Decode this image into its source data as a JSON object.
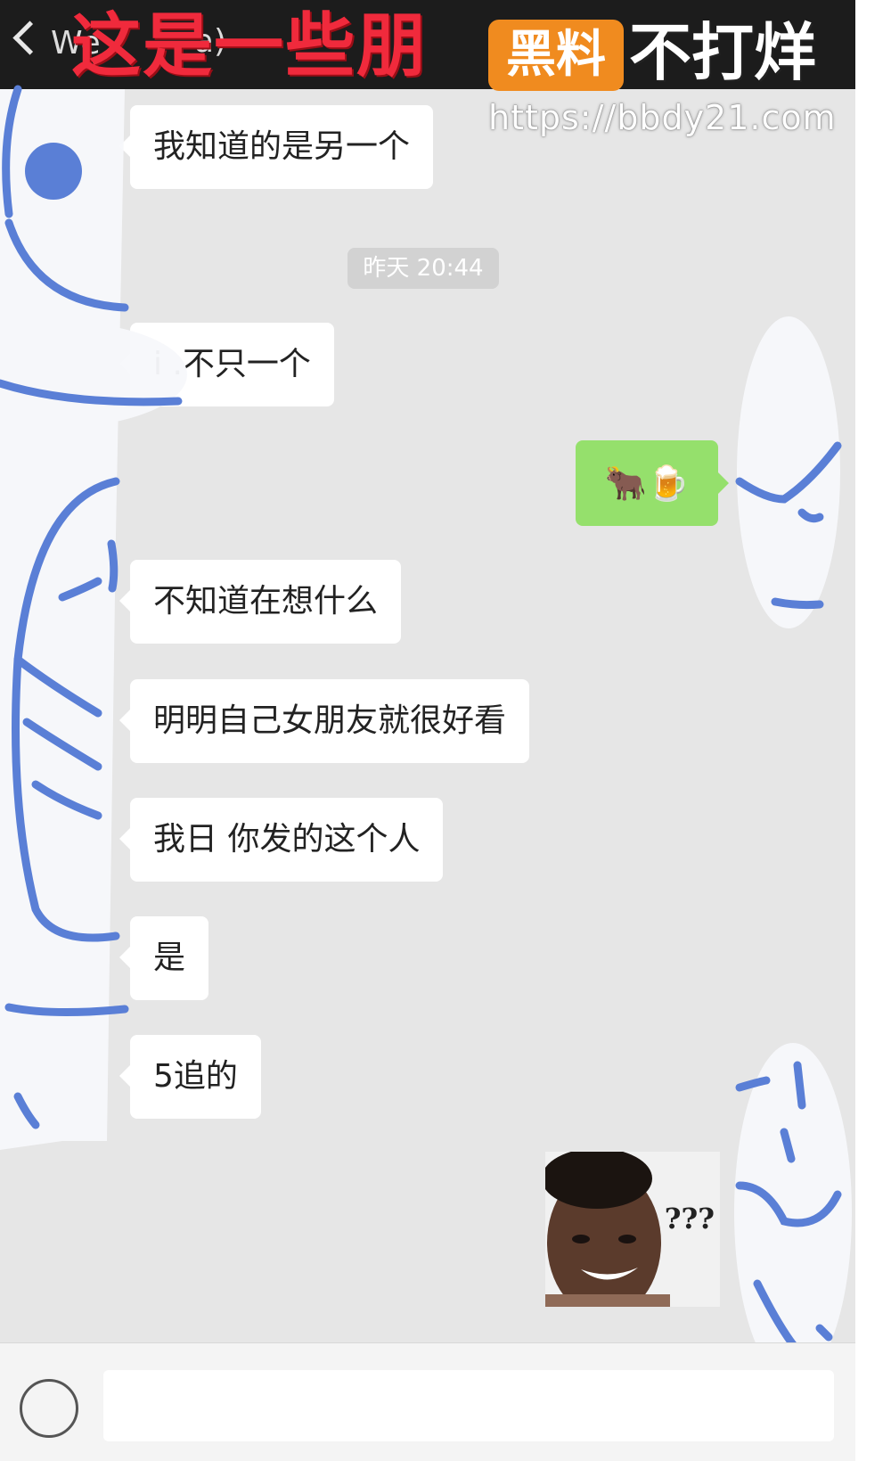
{
  "header": {
    "back_label": "We",
    "contact_name": "a)",
    "overlay_title": "这是一些朋",
    "badge": "黑料",
    "slogan": "不打烊",
    "url": "https://bbdy21.com"
  },
  "messages": [
    {
      "side": "in",
      "text": "我知道的是另一个"
    },
    {
      "type": "time",
      "text": "昨天 20:44"
    },
    {
      "side": "in",
      "text": "i  .不只一个"
    },
    {
      "side": "out",
      "text": "🐂🍺"
    },
    {
      "side": "in",
      "text": "不知道在想什么"
    },
    {
      "side": "in",
      "text": "明明自己女朋友就很好看"
    },
    {
      "side": "in",
      "text": "我日 你发的这个人"
    },
    {
      "side": "in",
      "text": "是"
    },
    {
      "side": "in",
      "text": "5追的"
    },
    {
      "side": "out",
      "type": "sticker",
      "caption": "???"
    }
  ],
  "colors": {
    "chat_bg": "#e6e6e6",
    "outgoing_bubble": "#95e06c",
    "incoming_bubble": "#ffffff",
    "scribble": "#5a7fd6",
    "banner_red": "#f02a3c",
    "badge_orange": "#f08b1f"
  }
}
